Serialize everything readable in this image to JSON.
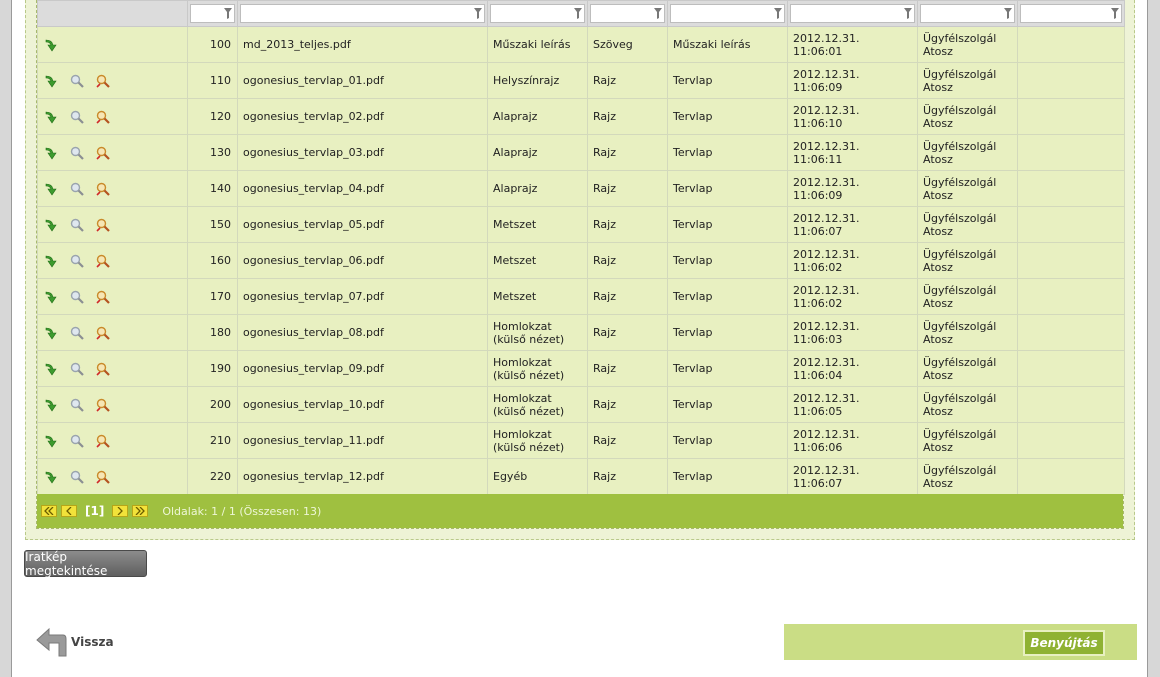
{
  "rows": [
    {
      "seq": "100",
      "file": "md_2013_teljes.pdf",
      "category": "Műszaki leírás",
      "type": "Szöveg",
      "kind": "Műszaki leírás",
      "date": "2012.12.31.",
      "time": "11:06:01",
      "user1": "Ügyfélszolgál",
      "user2": "Atosz",
      "full_icons": false
    },
    {
      "seq": "110",
      "file": "ogonesius_tervlap_01.pdf",
      "category": "Helyszínrajz",
      "type": "Rajz",
      "kind": "Tervlap",
      "date": "2012.12.31.",
      "time": "11:06:09",
      "user1": "Ügyfélszolgál",
      "user2": "Atosz",
      "full_icons": true
    },
    {
      "seq": "120",
      "file": "ogonesius_tervlap_02.pdf",
      "category": "Alaprajz",
      "type": "Rajz",
      "kind": "Tervlap",
      "date": "2012.12.31.",
      "time": "11:06:10",
      "user1": "Ügyfélszolgál",
      "user2": "Atosz",
      "full_icons": true
    },
    {
      "seq": "130",
      "file": "ogonesius_tervlap_03.pdf",
      "category": "Alaprajz",
      "type": "Rajz",
      "kind": "Tervlap",
      "date": "2012.12.31.",
      "time": "11:06:11",
      "user1": "Ügyfélszolgál",
      "user2": "Atosz",
      "full_icons": true
    },
    {
      "seq": "140",
      "file": "ogonesius_tervlap_04.pdf",
      "category": "Alaprajz",
      "type": "Rajz",
      "kind": "Tervlap",
      "date": "2012.12.31.",
      "time": "11:06:09",
      "user1": "Ügyfélszolgál",
      "user2": "Atosz",
      "full_icons": true
    },
    {
      "seq": "150",
      "file": "ogonesius_tervlap_05.pdf",
      "category": "Metszet",
      "type": "Rajz",
      "kind": "Tervlap",
      "date": "2012.12.31.",
      "time": "11:06:07",
      "user1": "Ügyfélszolgál",
      "user2": "Atosz",
      "full_icons": true
    },
    {
      "seq": "160",
      "file": "ogonesius_tervlap_06.pdf",
      "category": "Metszet",
      "type": "Rajz",
      "kind": "Tervlap",
      "date": "2012.12.31.",
      "time": "11:06:02",
      "user1": "Ügyfélszolgál",
      "user2": "Atosz",
      "full_icons": true
    },
    {
      "seq": "170",
      "file": "ogonesius_tervlap_07.pdf",
      "category": "Metszet",
      "type": "Rajz",
      "kind": "Tervlap",
      "date": "2012.12.31.",
      "time": "11:06:02",
      "user1": "Ügyfélszolgál",
      "user2": "Atosz",
      "full_icons": true
    },
    {
      "seq": "180",
      "file": "ogonesius_tervlap_08.pdf",
      "category": "Homlokzat (külső nézet)",
      "type": "Rajz",
      "kind": "Tervlap",
      "date": "2012.12.31.",
      "time": "11:06:03",
      "user1": "Ügyfélszolgál",
      "user2": "Atosz",
      "full_icons": true
    },
    {
      "seq": "190",
      "file": "ogonesius_tervlap_09.pdf",
      "category": "Homlokzat (külső nézet)",
      "type": "Rajz",
      "kind": "Tervlap",
      "date": "2012.12.31.",
      "time": "11:06:04",
      "user1": "Ügyfélszolgál",
      "user2": "Atosz",
      "full_icons": true
    },
    {
      "seq": "200",
      "file": "ogonesius_tervlap_10.pdf",
      "category": "Homlokzat (külső nézet)",
      "type": "Rajz",
      "kind": "Tervlap",
      "date": "2012.12.31.",
      "time": "11:06:05",
      "user1": "Ügyfélszolgál",
      "user2": "Atosz",
      "full_icons": true
    },
    {
      "seq": "210",
      "file": "ogonesius_tervlap_11.pdf",
      "category": "Homlokzat (külső nézet)",
      "type": "Rajz",
      "kind": "Tervlap",
      "date": "2012.12.31.",
      "time": "11:06:06",
      "user1": "Ügyfélszolgál",
      "user2": "Atosz",
      "full_icons": true
    },
    {
      "seq": "220",
      "file": "ogonesius_tervlap_12.pdf",
      "category": "Egyéb",
      "type": "Rajz",
      "kind": "Tervlap",
      "date": "2012.12.31.",
      "time": "11:06:07",
      "user1": "Ügyfélszolgál",
      "user2": "Atosz",
      "full_icons": true
    }
  ],
  "pager": {
    "current": "[1]",
    "info": "Oldalak: 1 / 1 (Összesen: 13)"
  },
  "buttons": {
    "view_document": "Iratkép megtekintése",
    "back": "Vissza",
    "submit": "Benyújtás"
  },
  "icons": {
    "download": "download-arrow-icon",
    "preview": "magnifier-icon",
    "edit": "edit-magnifier-icon",
    "filter": "funnel-icon",
    "back": "back-arrow-icon"
  },
  "colors": {
    "row_bg": "#e8f0c1",
    "pager_bg": "#9fc040",
    "submit_bg": "#8fb233"
  }
}
